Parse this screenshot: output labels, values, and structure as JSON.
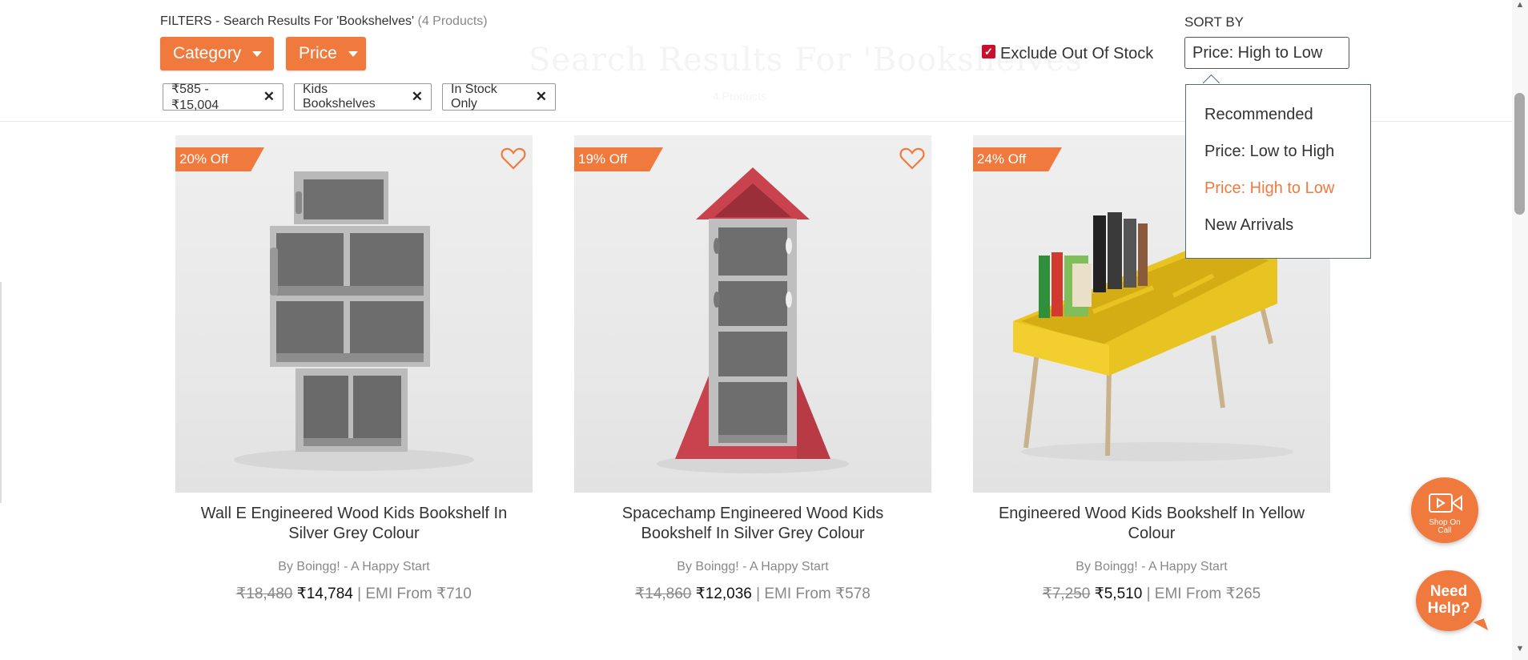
{
  "background": {
    "title": "Search Results For 'Bookshelves'",
    "subtitle": "4 Products"
  },
  "filters": {
    "prefix": "FILTERS - Search Results For 'Bookshelves'",
    "count": "(4 Products)",
    "category_label": "Category",
    "price_label": "Price",
    "chips": [
      {
        "label": "₹585 - ₹15,004"
      },
      {
        "label": "Kids Bookshelves"
      },
      {
        "label": "In Stock Only"
      }
    ],
    "exclude_out_of_stock": {
      "label": "Exclude Out Of Stock",
      "checked": true
    }
  },
  "sort": {
    "label": "SORT BY",
    "selected": "Price: High to Low",
    "options": [
      "Recommended",
      "Price: Low to High",
      "Price: High to Low",
      "New Arrivals"
    ]
  },
  "products": [
    {
      "discount": "20% Off",
      "title_line1": "Wall E Engineered Wood Kids Bookshelf In",
      "title_line2": "Silver Grey Colour",
      "brand": "By Boingg! - A Happy Start",
      "mrp": "₹18,480",
      "price": "₹14,784",
      "emi": "| EMI From ₹710",
      "icon": "robot-bookshelf-image"
    },
    {
      "discount": "19% Off",
      "title_line1": "Spacechamp Engineered Wood Kids",
      "title_line2": "Bookshelf In Silver Grey Colour",
      "brand": "By Boingg! - A Happy Start",
      "mrp": "₹14,860",
      "price": "₹12,036",
      "emi": "| EMI From ₹578",
      "icon": "rocket-bookshelf-image"
    },
    {
      "discount": "24% Off",
      "title_line1": "Engineered Wood Kids Bookshelf In Yellow",
      "title_line2": "Colour",
      "brand": "By Boingg! - A Happy Start",
      "mrp": "₹7,250",
      "price": "₹5,510",
      "emi": "| EMI From ₹265",
      "icon": "yellow-trough-bookshelf-image"
    }
  ],
  "floating": {
    "shop_on_call_line1": "Shop On",
    "shop_on_call_line2": "Call",
    "need_help_line1": "Need",
    "need_help_line2": "Help?"
  },
  "colors": {
    "accent": "#f07a3e",
    "checkbox": "#c8102e"
  }
}
